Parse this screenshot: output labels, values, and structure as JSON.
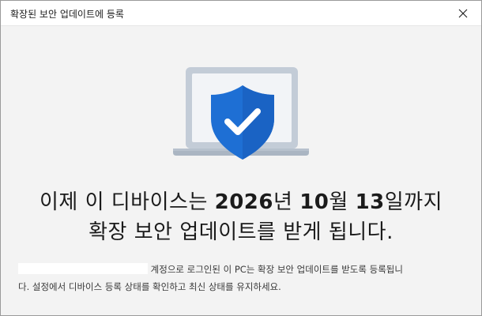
{
  "window": {
    "title": "확장된 보안 업데이트에 등록"
  },
  "headline": {
    "line1_prefix": "이제 이 디바이스는 ",
    "year": "2026",
    "year_suffix": "년 ",
    "month": "10",
    "month_suffix": "월 ",
    "day": "13",
    "day_suffix": "일까지",
    "line2": "확장 보안 업데이트를 받게 됩니다."
  },
  "description": {
    "line1_after_redaction": "계정으로 로그인된 이 PC는 확장 보안 업데이트를 받도록 등록됩니",
    "line2": "다. 설정에서 디바이스 등록 상태를 확인하고 최신 상태를 유지하세요."
  },
  "icons": {
    "close": "close-icon",
    "hero": "laptop-shield-check-icon"
  },
  "colors": {
    "shield": "#1f6fd1",
    "shield_dark": "#155db8",
    "laptop_frame": "#b9c3cf",
    "laptop_screen": "#eef1f5",
    "background": "#f3f3f3",
    "titlebar": "#ffffff"
  }
}
